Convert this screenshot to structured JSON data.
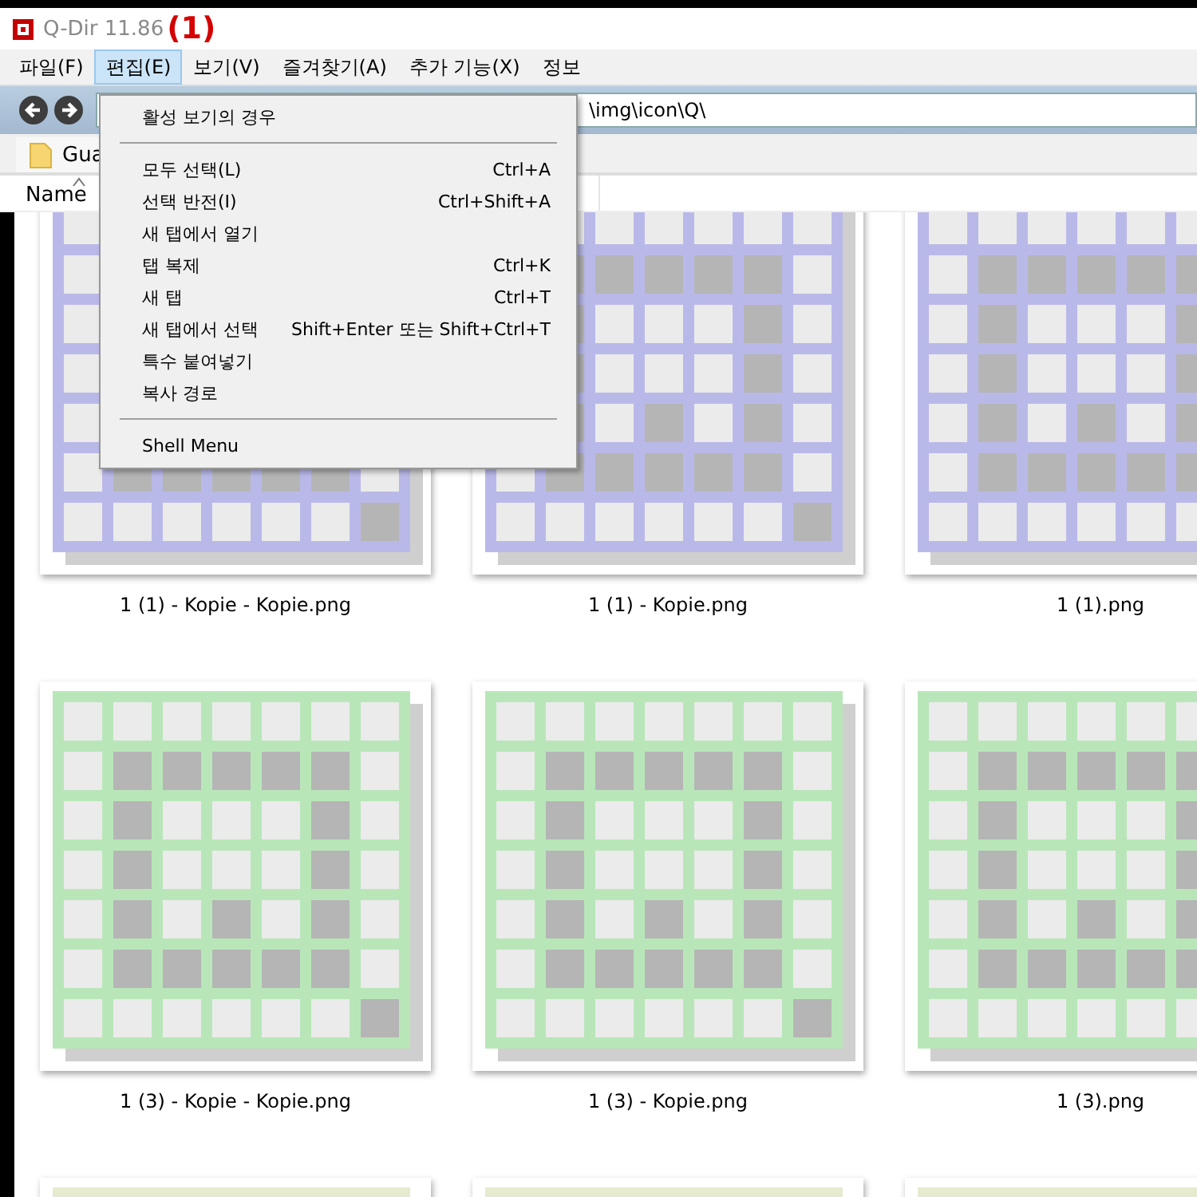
{
  "window": {
    "title": "Q-Dir 11.86",
    "annotation": "(1)"
  },
  "menu_bar": [
    {
      "label": "파일(F)",
      "selected": false
    },
    {
      "label": "편집(E)",
      "selected": true
    },
    {
      "label": "보기(V)",
      "selected": false
    },
    {
      "label": "즐겨찾기(A)",
      "selected": false
    },
    {
      "label": "추가 기능(X)",
      "selected": false
    },
    {
      "label": "정보",
      "selected": false
    }
  ],
  "dropdown": [
    {
      "kind": "item",
      "label": "활성 보기의 경우"
    },
    {
      "kind": "separator"
    },
    {
      "kind": "item",
      "label": "모두 선택(L)",
      "shortcut": "Ctrl+A"
    },
    {
      "kind": "item",
      "label": "선택 반전(I)",
      "shortcut": "Ctrl+Shift+A"
    },
    {
      "kind": "item",
      "label": "새 탭에서 열기"
    },
    {
      "kind": "item",
      "label": "탭 복제",
      "shortcut": "Ctrl+K"
    },
    {
      "kind": "item",
      "label": "새 탭",
      "shortcut": "Ctrl+T"
    },
    {
      "kind": "item",
      "label": "새 탭에서 선택",
      "shortcut": "Shift+Enter 또는 Shift+Ctrl+T"
    },
    {
      "kind": "item",
      "label": "특수 붙여넣기"
    },
    {
      "kind": "item",
      "label": "복사 경로"
    },
    {
      "kind": "separator"
    },
    {
      "kind": "item",
      "label": "Shell Menu"
    }
  ],
  "address_bar": {
    "value": "\\img\\icon\\Q\\"
  },
  "tab": {
    "label": "Gua"
  },
  "column_header": {
    "label": "Name",
    "sorted": true
  },
  "files": [
    {
      "name": "1 (1) - Kopie - Kopie.png",
      "color": "#b9b9e9"
    },
    {
      "name": "1 (1) - Kopie.png",
      "color": "#b9b9e9"
    },
    {
      "name": "1 (1).png",
      "color": "#b9b9e9"
    },
    {
      "name": "1 (3) - Kopie - Kopie.png",
      "color": "#b9e6b9"
    },
    {
      "name": "1 (3) - Kopie.png",
      "color": "#b9e6b9"
    },
    {
      "name": "1 (3).png",
      "color": "#b9e6b9"
    },
    {
      "color": "#e6ebcf"
    },
    {
      "color": "#e6ebcf"
    },
    {
      "color": "#e6ebcf"
    }
  ]
}
